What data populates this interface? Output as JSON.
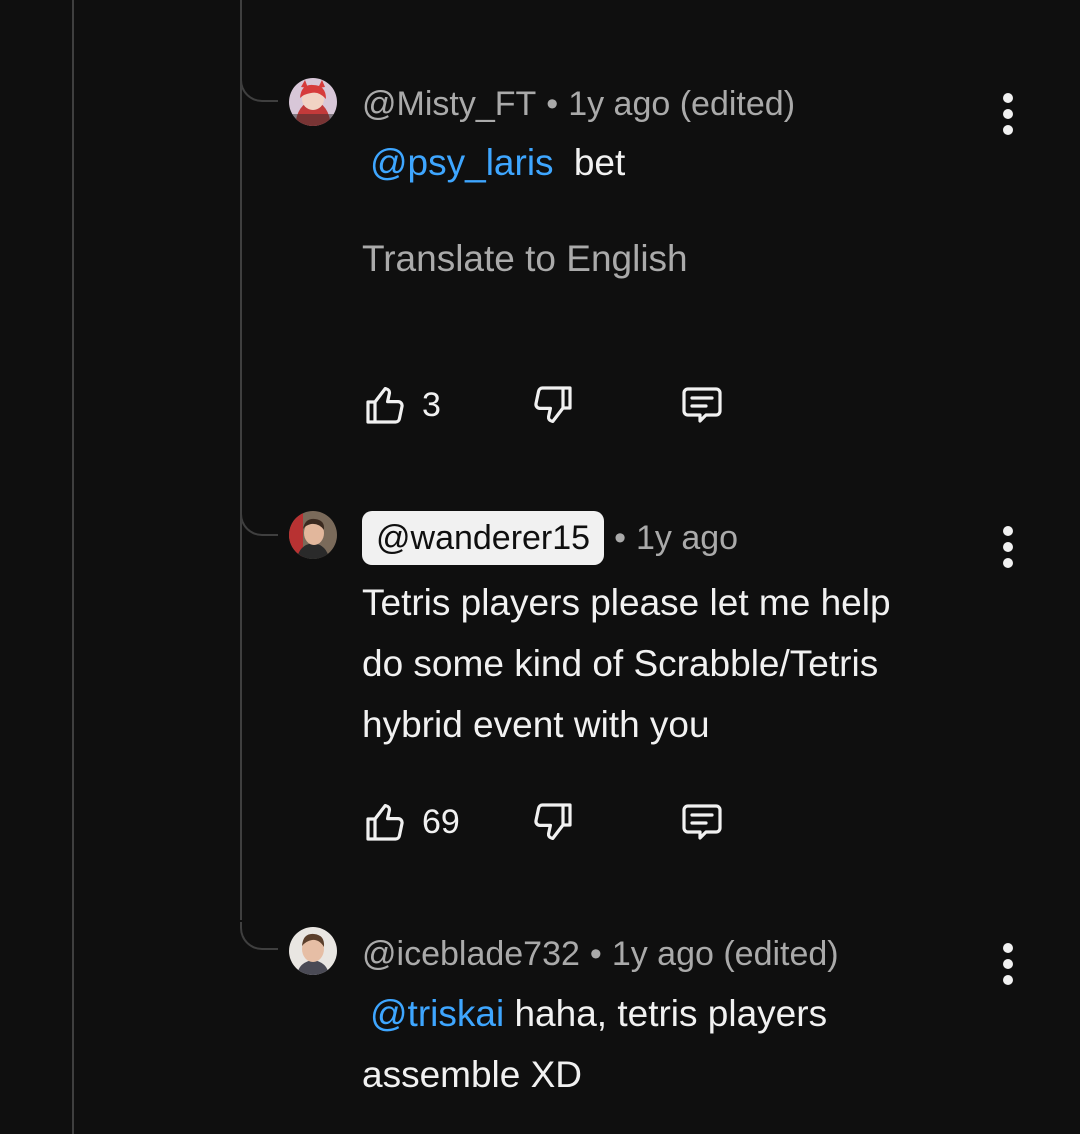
{
  "comments": [
    {
      "handle": "@Misty_FT",
      "separator": "•",
      "time": "1y ago (edited)",
      "mention": "@psy_laris",
      "text": " bet",
      "translate_label": "Translate to English",
      "like_count": "3"
    },
    {
      "handle": "@wanderer15",
      "separator": "•",
      "time": "1y ago",
      "lines": [
        "Tetris players please let me help",
        "do some kind of Scrabble/Tetris",
        "hybrid event with you"
      ],
      "like_count": "69"
    },
    {
      "handle": "@iceblade732",
      "separator": "•",
      "time": "1y ago (edited)",
      "mention": "@triskai",
      "text_line1": " haha, tetris players",
      "text_line2": "assemble XD"
    }
  ],
  "icons": {
    "like": "thumbs-up-outline",
    "dislike": "thumbs-down-outline",
    "reply": "comment-outline",
    "menu": "vertical-ellipsis"
  },
  "colors": {
    "background": "#0f0f0f",
    "mention": "#3ea6ff",
    "secondary_text": "#aaaaaa",
    "primary_text": "#f1f1f1",
    "thread_line": "#3f3f3f"
  }
}
